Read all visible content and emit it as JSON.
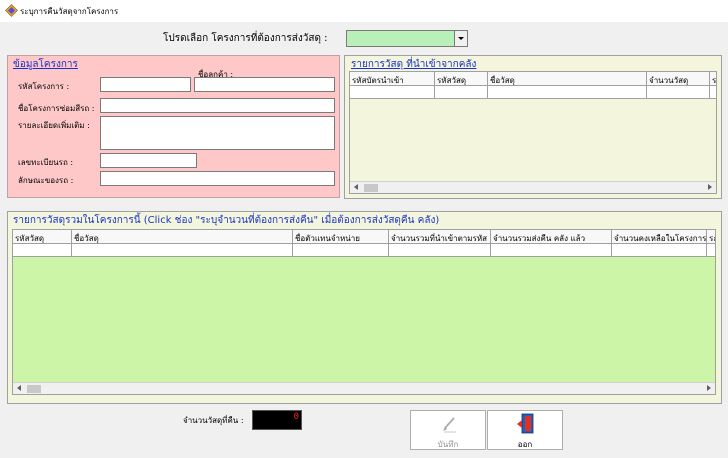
{
  "window": {
    "title": "ระบุการคืนวัสดุจากโครงการ"
  },
  "project_select": {
    "prompt": "โปรดเลือก โครงการที่ต้องการส่งวัสดุ :",
    "value": ""
  },
  "project_info": {
    "title": "ข้อมูลโครงการ",
    "project_code_label": "รหัสโครงการ :",
    "customer_name_label": "ชื่อลูกค้า :",
    "repair_project_name_label": "ชื่อโครงการซ่อมสีรถ :",
    "details_label": "รายละเอียดเพิ่มเติม :",
    "registration_label": "เลขทะเบียนรถ :",
    "vehicle_type_label": "ลักษณะของรถ :",
    "project_code_value": "",
    "customer_name_value": "",
    "repair_project_name_value": "",
    "details_value": "",
    "registration_value": "",
    "vehicle_type_value": ""
  },
  "warehouse_grid": {
    "title": "รายการวัสดุ ที่นำเข้าจากคลัง",
    "columns": [
      "รหัสบัตรนำเข้า",
      "รหัสวัสดุ",
      "ชื่อวัสดุ",
      "จำนวนวัสดุ",
      "ร"
    ]
  },
  "project_grid": {
    "title": "รายการวัสดุรวมในโครงการนี้ (Click ช่อง \"ระบุจำนวนที่ต้องการส่งคืน\" เมื่อต้องการส่งวัสดุคืน คลัง)",
    "columns": [
      "รหัสวัสดุ",
      "ชื่อวัสดุ",
      "ชื่อตัวแทนจำหน่าย",
      "จำนวนรวมที่นำเข้าตามรหัส",
      "จำนวนรวมส่งคืน คลัง แล้ว",
      "จำนวนคงเหลือในโครงการ",
      "ระ"
    ]
  },
  "footer": {
    "return_count_label": "จำนวนวัสดุที่คืน :",
    "return_count_value": "0",
    "save_label": "บันทึก",
    "exit_label": "ออก"
  }
}
